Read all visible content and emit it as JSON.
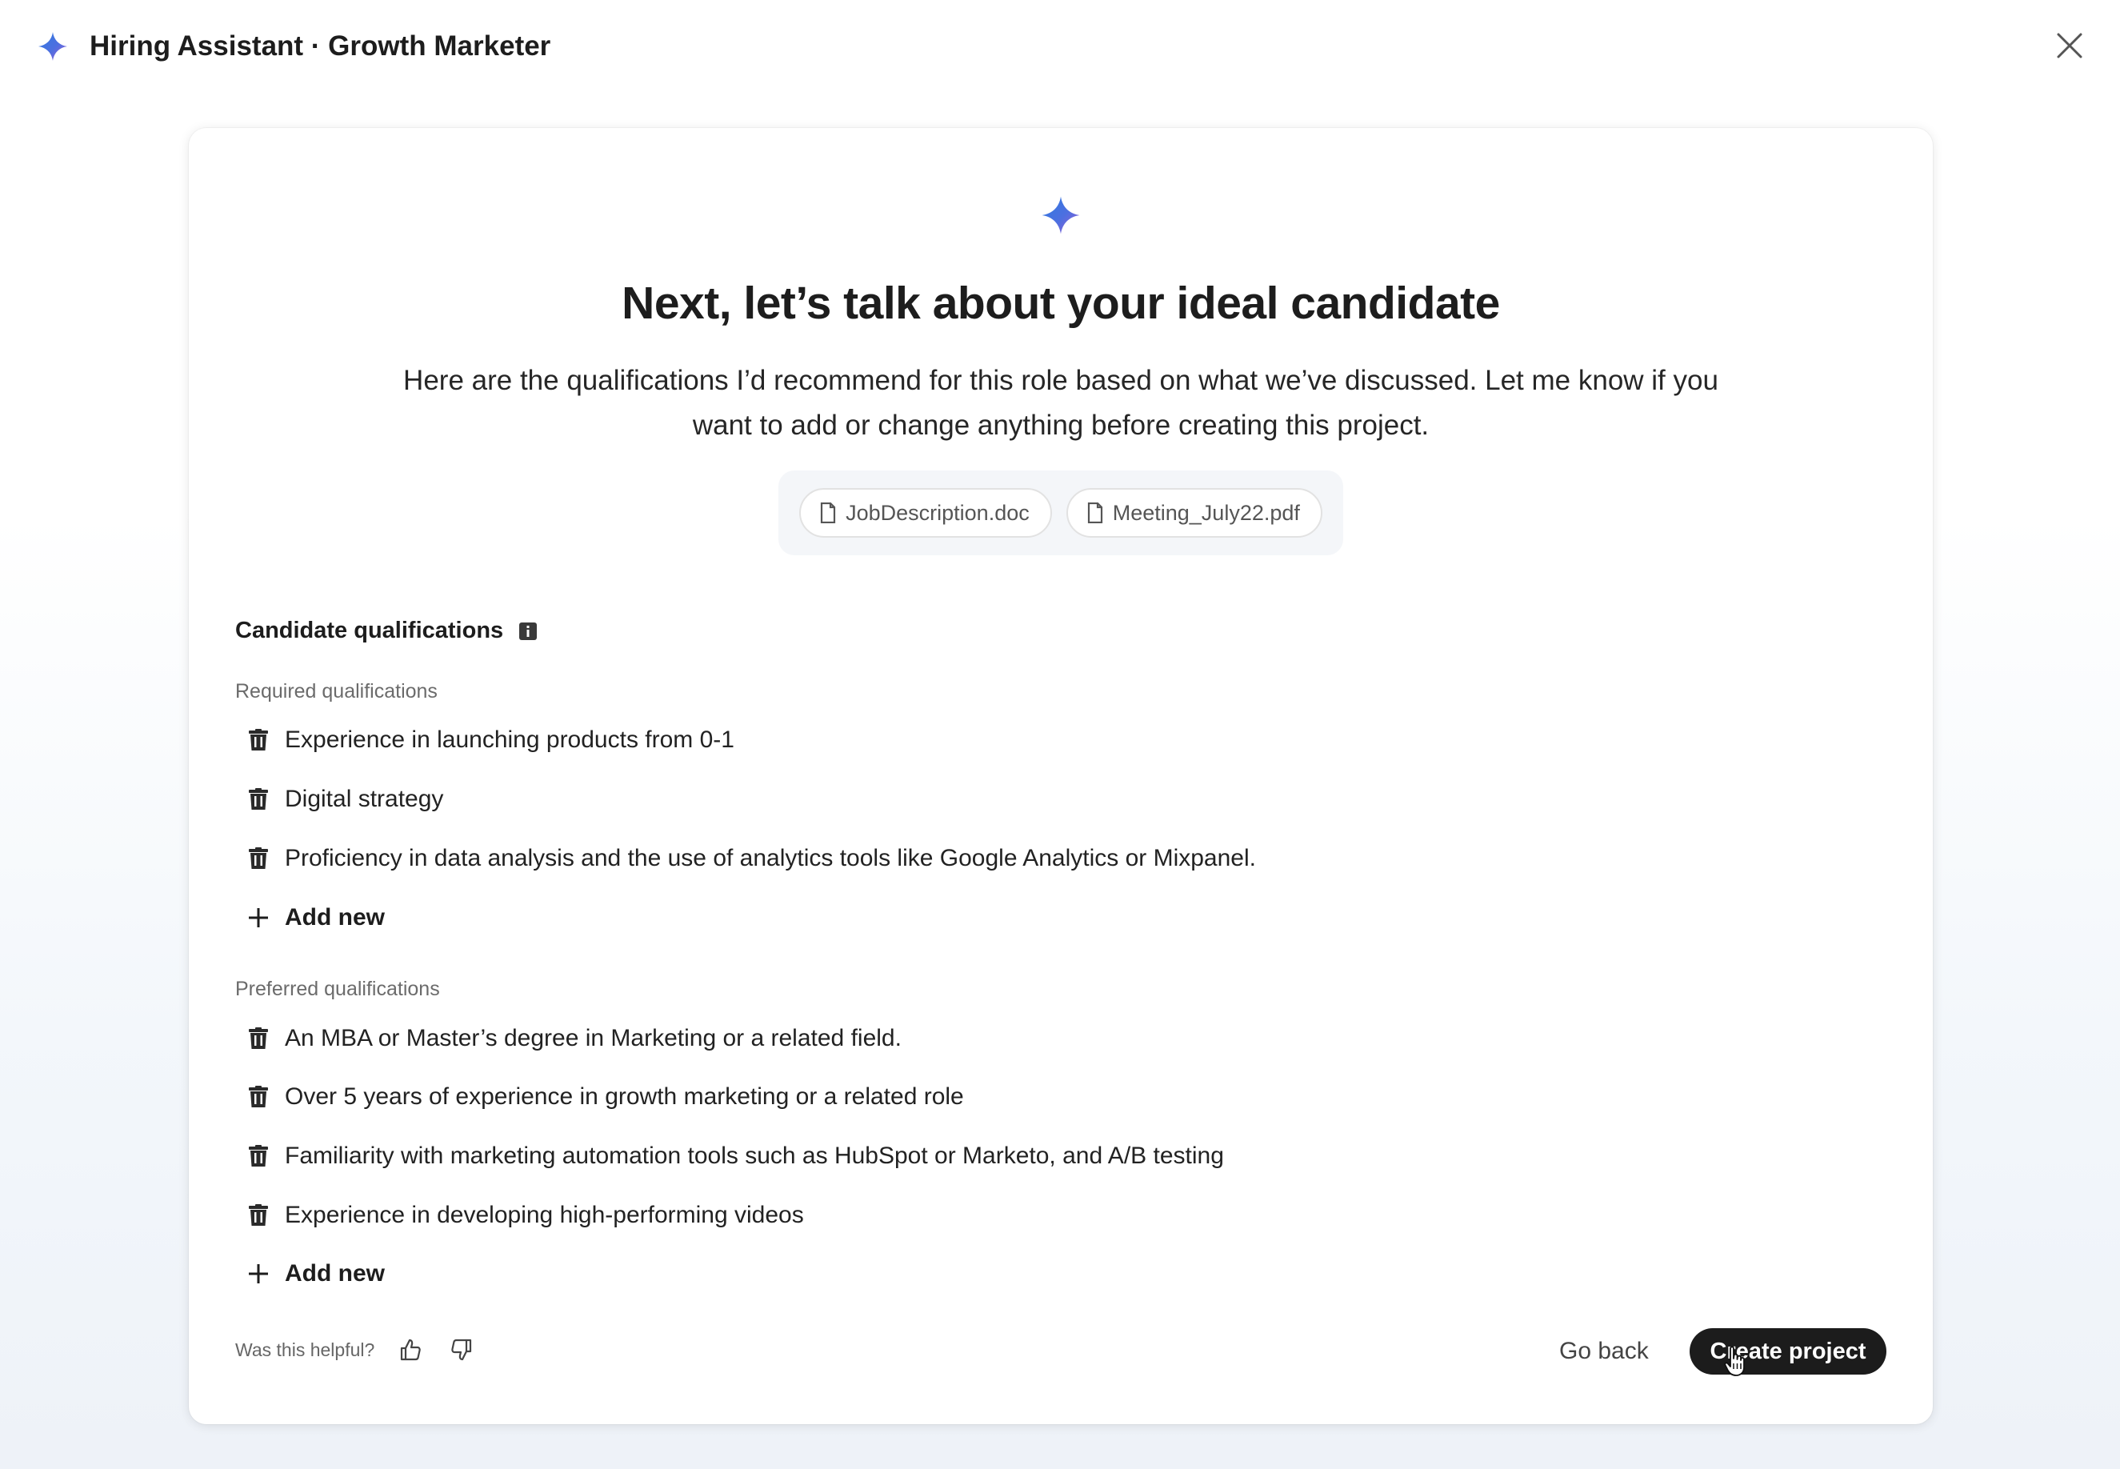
{
  "header": {
    "title": "Hiring Assistant · Growth Marketer"
  },
  "card": {
    "headline": "Next, let’s talk about your ideal candidate",
    "subtext": "Here are the qualifications I’d recommend for this role based on what we’ve discussed. Let me know if you want to add or change anything before creating this project.",
    "attachments": [
      "JobDescription.doc",
      "Meeting_July22.pdf"
    ]
  },
  "qualifications": {
    "heading": "Candidate qualifications",
    "required_label": "Required qualifications",
    "required": [
      "Experience in launching products from 0-1",
      "Digital strategy",
      "Proficiency in data analysis and the use of analytics tools like Google Analytics or Mixpanel."
    ],
    "preferred_label": "Preferred qualifications",
    "preferred": [
      "An MBA or Master’s degree in Marketing or a related field.",
      "Over 5 years of experience in growth marketing or a related role",
      "Familiarity with marketing automation tools such as HubSpot or Marketo, and A/B testing",
      "Experience in developing high-performing videos"
    ],
    "add_new_label": "Add new"
  },
  "footer": {
    "helpful_label": "Was this helpful?",
    "go_back_label": "Go back",
    "create_label": "Create project"
  },
  "colors": {
    "accent_dark": "#1c1c1c",
    "spark_blue": "#3b6fd8",
    "spark_purple": "#8a63d2"
  }
}
